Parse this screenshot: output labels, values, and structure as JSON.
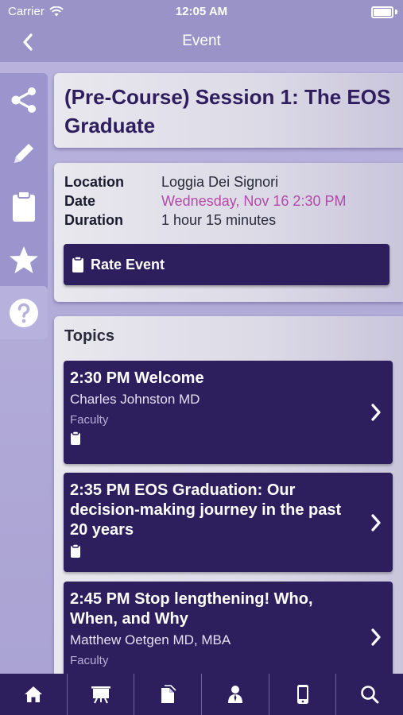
{
  "status": {
    "carrier": "Carrier",
    "time": "12:05 AM"
  },
  "nav": {
    "title": "Event"
  },
  "sidebar": {
    "items": [
      {
        "icon": "share-icon"
      },
      {
        "icon": "pencil-icon"
      },
      {
        "icon": "clipboard-icon"
      },
      {
        "icon": "star-icon"
      },
      {
        "icon": "help-icon",
        "active": true
      }
    ]
  },
  "event": {
    "title": "(Pre-Course) Session 1: The EOS Graduate",
    "location_label": "Location",
    "location": "Loggia Dei Signori",
    "date_label": "Date",
    "date": "Wednesday, Nov 16 2:30 PM",
    "duration_label": "Duration",
    "duration": "1 hour 15 minutes",
    "rate_label": "Rate Event"
  },
  "topics": {
    "heading": "Topics",
    "items": [
      {
        "title": "2:30 PM  Welcome",
        "speaker": "Charles Johnston MD",
        "role": "Faculty",
        "has_clipboard": true
      },
      {
        "title": "2:35 PM  EOS Graduation: Our decision-making journey in the past 20 years",
        "speaker": "",
        "role": "",
        "has_clipboard": true
      },
      {
        "title": "2:45 PM  Stop lengthening! Who, When, and Why",
        "speaker": "Matthew Oetgen MD, MBA",
        "role": "Faculty",
        "has_clipboard": false
      }
    ]
  },
  "tabbar": {
    "items": [
      {
        "icon": "home-icon"
      },
      {
        "icon": "presentation-icon"
      },
      {
        "icon": "documents-icon"
      },
      {
        "icon": "person-icon"
      },
      {
        "icon": "mobile-icon"
      },
      {
        "icon": "search-icon"
      }
    ]
  },
  "colors": {
    "accent": "#2d1f5e",
    "date": "#b24aa8",
    "background": "#9a93c8"
  }
}
